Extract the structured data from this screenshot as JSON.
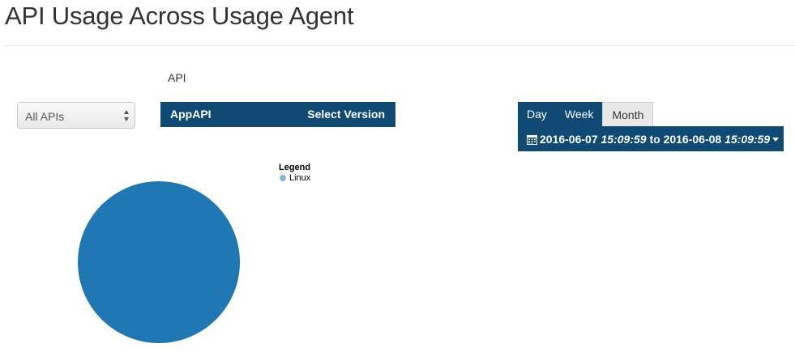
{
  "page": {
    "title": "API Usage Across Usage Agent"
  },
  "filters": {
    "api_label": "API",
    "api_select_value": "All APIs",
    "api_name": "AppAPI",
    "select_version_label": "Select Version"
  },
  "range": {
    "tabs": [
      {
        "label": "Day",
        "active": false
      },
      {
        "label": "Week",
        "active": false
      },
      {
        "label": "Month",
        "active": true
      }
    ],
    "from_date": "2016-06-07",
    "from_time": "15:09:59",
    "to_word": "to",
    "to_date": "2016-06-08",
    "to_time": "15:09:59"
  },
  "icons": {
    "calendar": "calendar-icon",
    "caret": "caret-down-icon",
    "select_arrows": "select-arrows-icon"
  },
  "colors": {
    "header_bar": "#0e4a74",
    "pie_fill": "#1f77b4",
    "legend_dot": "#8ab4dc"
  },
  "chart_data": {
    "type": "pie",
    "legend_title": "Legend",
    "categories": [
      "Linux"
    ],
    "values": [
      100
    ]
  }
}
